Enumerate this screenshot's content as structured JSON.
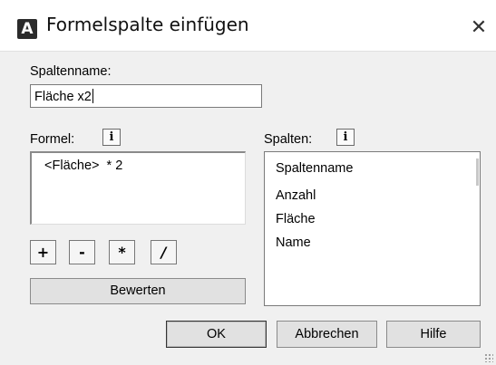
{
  "window": {
    "app_icon_letter": "A",
    "title": "Formelspalte einfügen",
    "close_glyph": "✕"
  },
  "column_name": {
    "label": "Spaltenname:",
    "value": "Fläche x2"
  },
  "formula": {
    "label": "Formel:",
    "info_glyph": "i",
    "value": " <Fläche>  * 2",
    "operators": [
      "+",
      "-",
      "*",
      "/"
    ],
    "evaluate_label": "Bewerten"
  },
  "columns": {
    "label": "Spalten:",
    "info_glyph": "i",
    "items": [
      "Spaltenname",
      "Anzahl",
      "Fläche",
      "Name"
    ]
  },
  "buttons": {
    "ok": "OK",
    "cancel": "Abbrechen",
    "help": "Hilfe"
  },
  "icons": {
    "app": "autocad-a-icon",
    "close": "close-icon",
    "info": "info-icon",
    "resize": "resize-grip-icon"
  }
}
